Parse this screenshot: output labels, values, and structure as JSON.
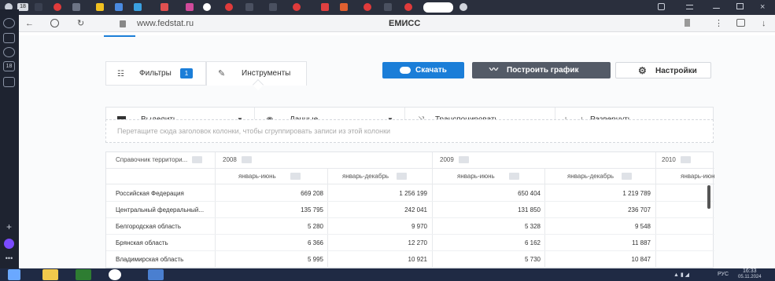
{
  "browser": {
    "url": "www.fedstat.ru",
    "page_title": "ЕМИСС",
    "tab_badge": "18",
    "rail_badge": "18"
  },
  "toolbar": {
    "tab_filters": "Фильтры",
    "filters_count": "1",
    "tab_tools": "Инструменты",
    "download_label": "Скачать",
    "chart_label": "Построить график",
    "settings_label": "Настройки"
  },
  "tools": {
    "select_label": "Выделить",
    "data_label": "Данные",
    "transpose_label": "Транспонировать",
    "expand_icon": "|← →|",
    "expand_label": "Развернуть"
  },
  "dropzone": {
    "text": "Перетащите сюда заголовок колонки, чтобы сгруппировать записи из этой колонки"
  },
  "table": {
    "territory_header": "Справочник территори...",
    "years": [
      "2008",
      "2009",
      "2010"
    ],
    "periods": [
      "январь-июнь",
      "январь-декабрь",
      "январь-июнь",
      "январь-декабрь",
      "январь-июн"
    ],
    "rows": [
      {
        "name": "Российская Федерация",
        "v": [
          "669 208",
          "1 256 199",
          "650 404",
          "1 219 789"
        ]
      },
      {
        "name": "Центральный федеральный...",
        "v": [
          "135 795",
          "242 041",
          "131 850",
          "236 707"
        ]
      },
      {
        "name": "Белгородская область",
        "v": [
          "5 280",
          "9 970",
          "5 328",
          "9 548"
        ]
      },
      {
        "name": "Брянская область",
        "v": [
          "6 366",
          "12 270",
          "6 162",
          "11 887"
        ]
      },
      {
        "name": "Владимирская область",
        "v": [
          "5 995",
          "10 921",
          "5 730",
          "10 847"
        ]
      }
    ]
  },
  "taskbar": {
    "lang": "РУС",
    "time": "16:33",
    "date": "05.11.2024"
  },
  "colors": {
    "primary_blue": "#1b7ed8",
    "dark_button": "#545b67",
    "badge_blue": "#1b7ed8"
  }
}
